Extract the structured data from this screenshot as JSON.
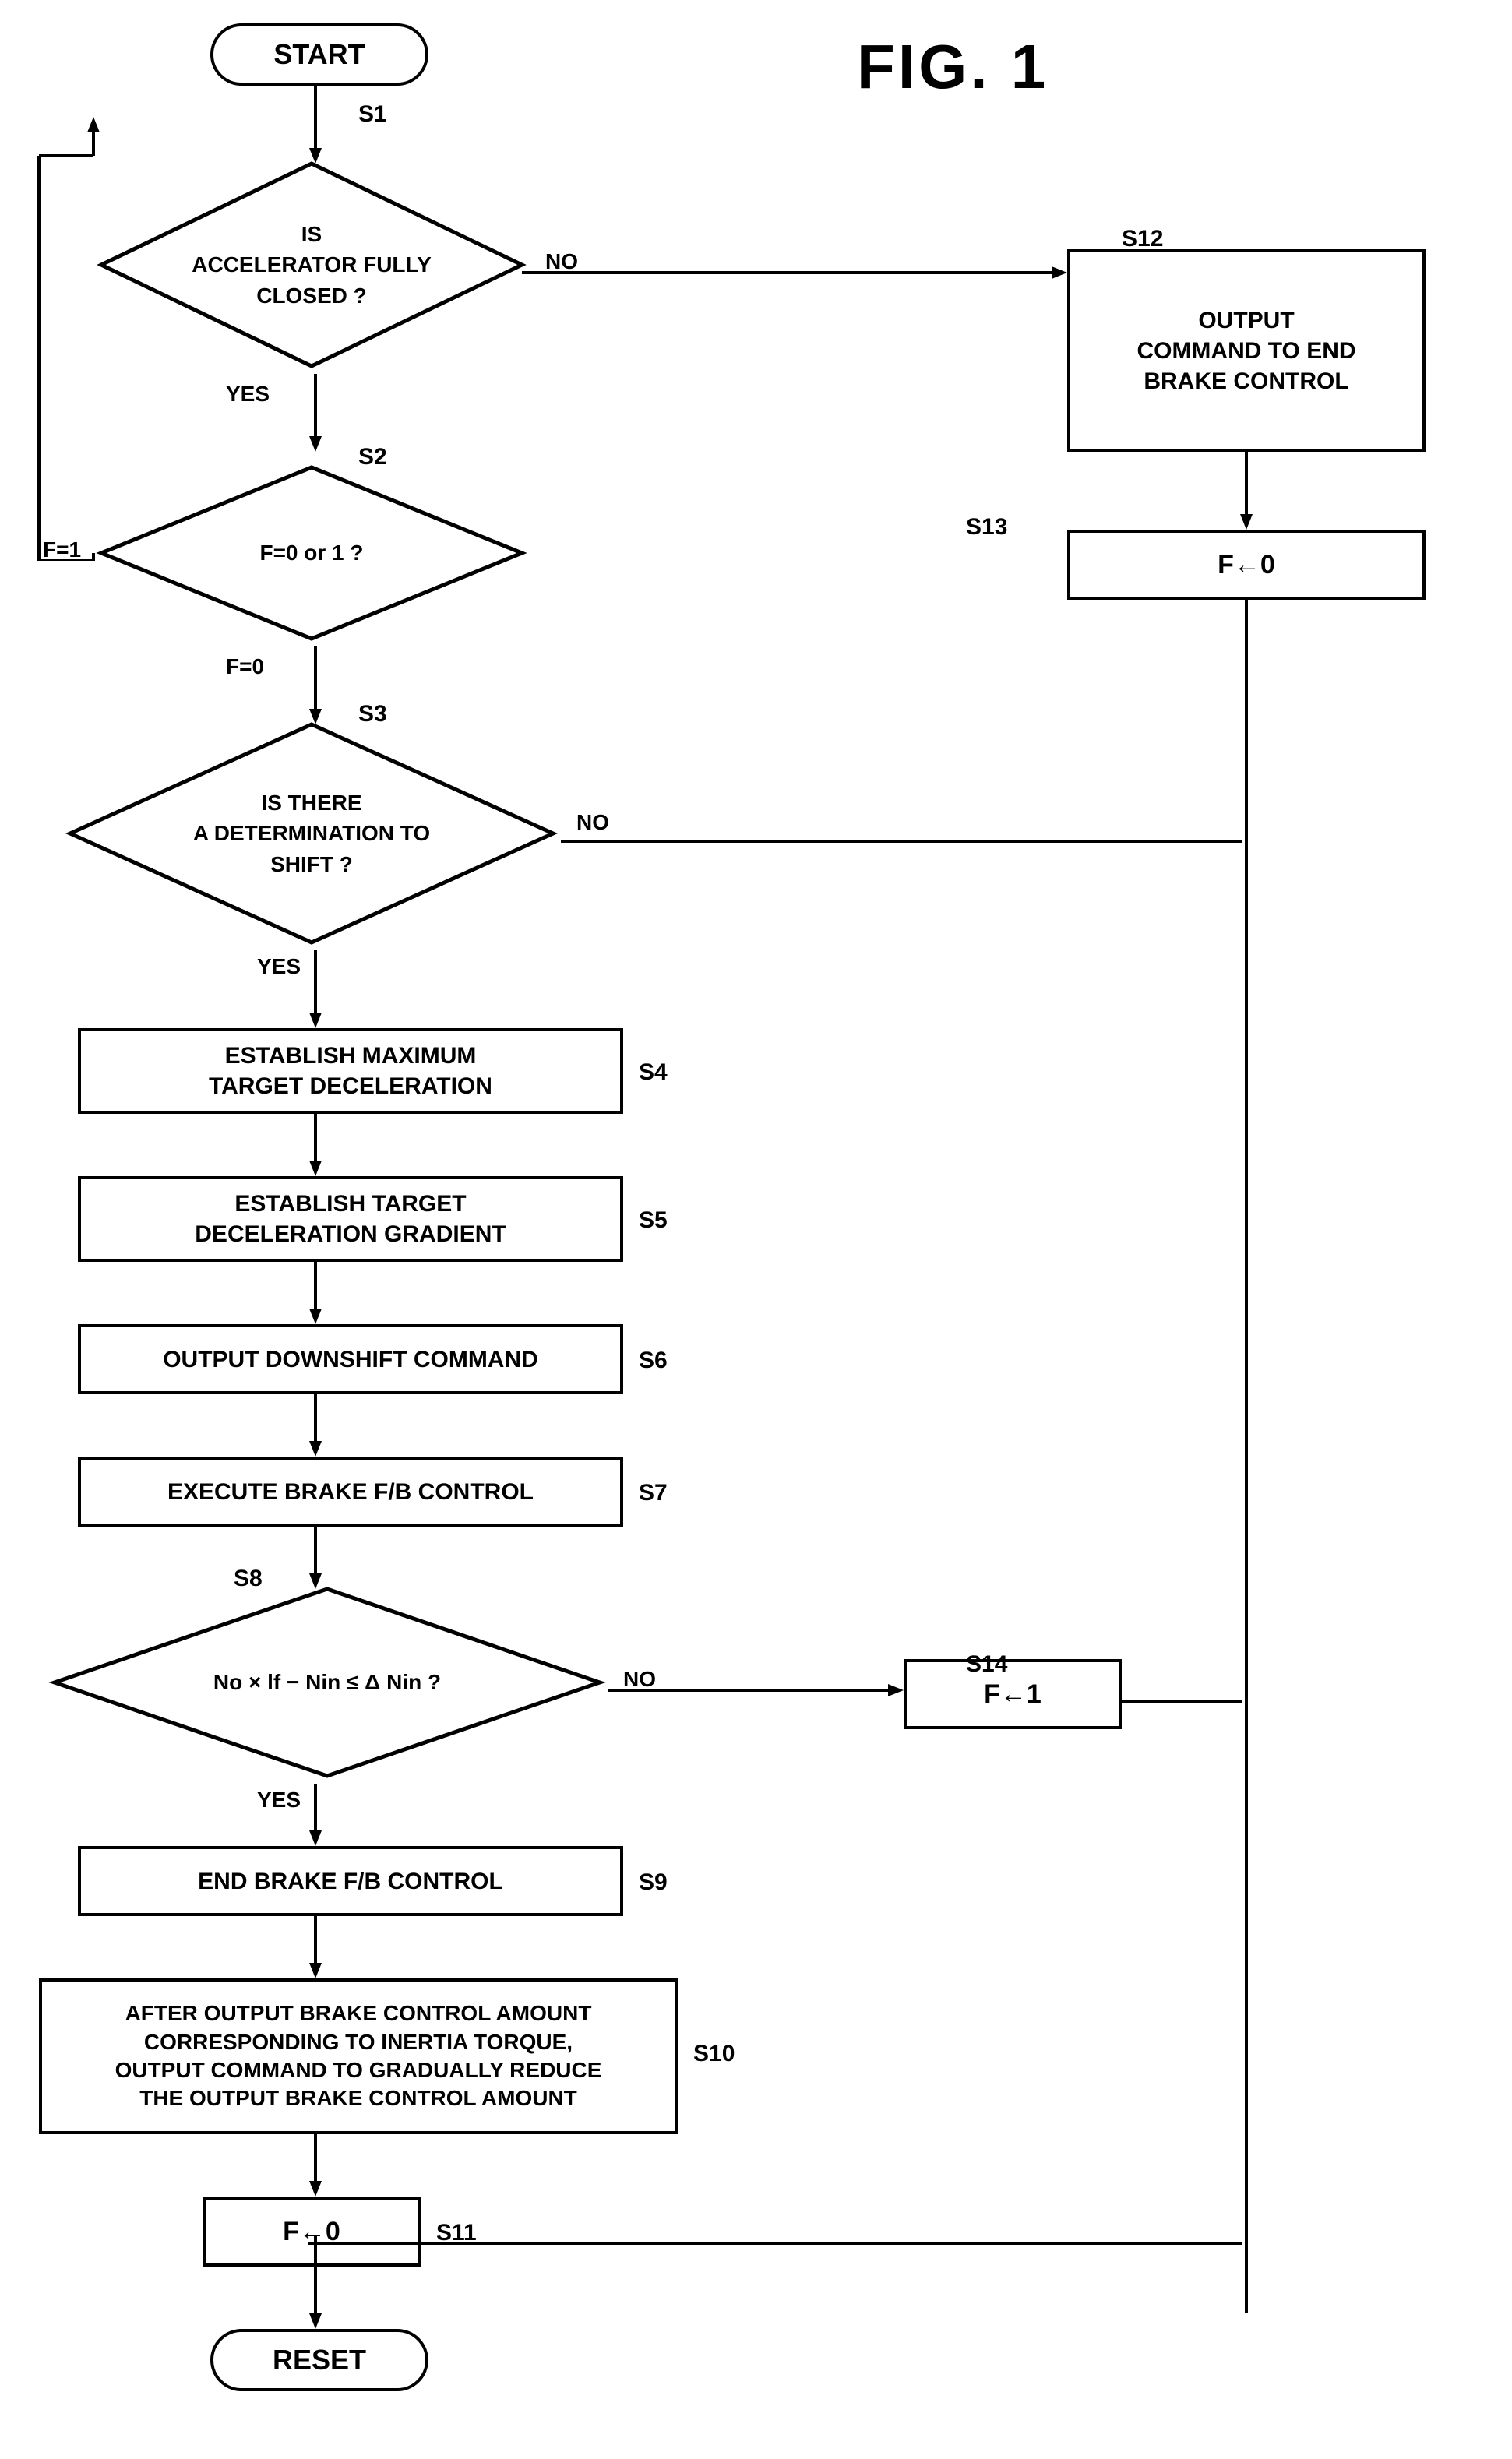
{
  "title": "FIG. 1",
  "nodes": {
    "start": "START",
    "s1_label": "S1",
    "s1_text": "IS\nACCELERATOR FULLY\nCLOSED ?",
    "s1_yes": "YES",
    "s1_no": "NO",
    "s2_label": "S2",
    "s2_text": "F=0 or 1 ?",
    "s2_f1": "F=1",
    "s2_f0": "F=0",
    "s3_label": "S3",
    "s3_text": "IS THERE\nA DETERMINATION TO\nSHIFT ?",
    "s3_yes": "YES",
    "s3_no": "NO",
    "s4_label": "S4",
    "s4_text": "ESTABLISH MAXIMUM\nTARGET DECELERATION",
    "s5_label": "S5",
    "s5_text": "ESTABLISH TARGET\nDECELERATION GRADIENT",
    "s6_label": "S6",
    "s6_text": "OUTPUT DOWNSHIFT COMMAND",
    "s7_label": "S7",
    "s7_text": "EXECUTE BRAKE F/B CONTROL",
    "s8_label": "S8",
    "s8_text": "No × lf − Nin ≤ Δ Nin ?",
    "s8_yes": "YES",
    "s8_no": "NO",
    "s9_label": "S9",
    "s9_text": "END BRAKE F/B CONTROL",
    "s10_label": "S10",
    "s10_text": "AFTER OUTPUT BRAKE CONTROL AMOUNT\nCORRESPONDING TO INERTIA TORQUE,\nOUTPUT COMMAND TO GRADUALLY REDUCE\nTHE OUTPUT BRAKE CONTROL AMOUNT",
    "s11_label": "S11",
    "s11_text": "F←0",
    "s12_label": "S12",
    "s12_text": "OUTPUT\nCOMMAND TO END\nBRAKE CONTROL",
    "s13_label": "S13",
    "s13_text": "F←0",
    "s14_label": "S14",
    "s14_text": "F←1",
    "reset": "RESET"
  }
}
